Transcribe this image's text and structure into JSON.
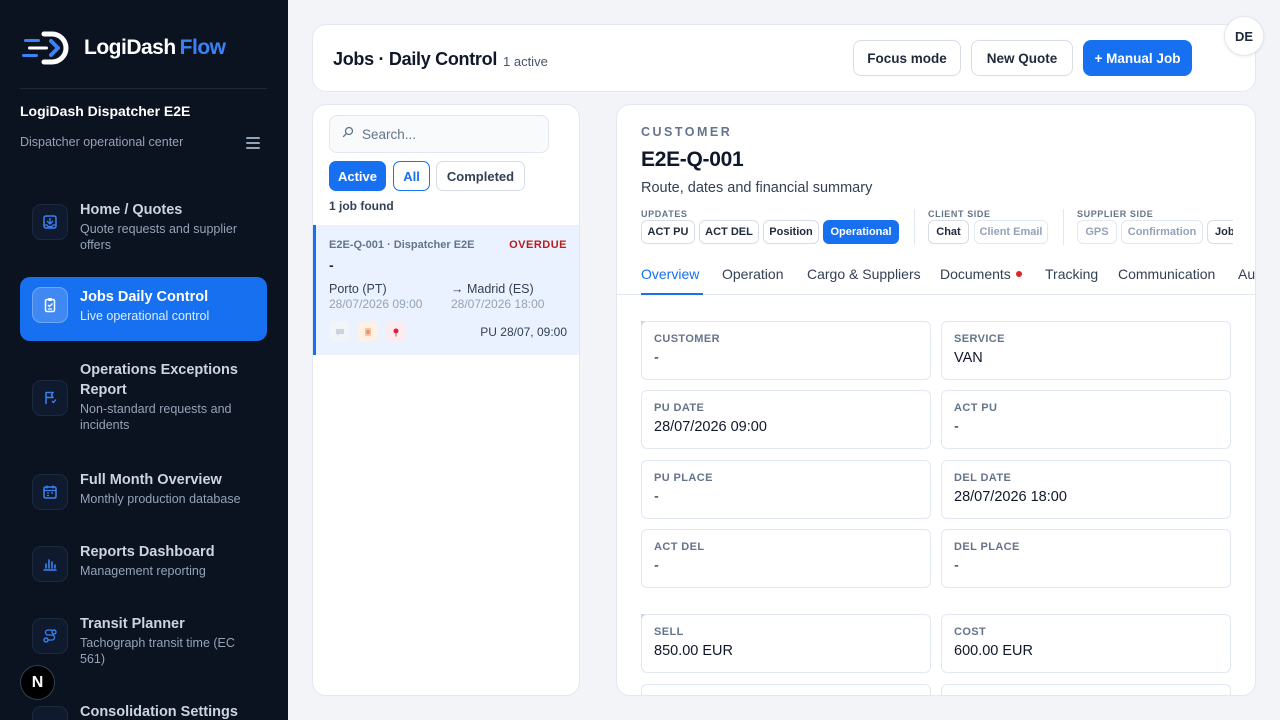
{
  "brand": {
    "name": "LogiDash",
    "accent": "Flow"
  },
  "org": {
    "name": "LogiDash Dispatcher E2E",
    "subtitle": "Dispatcher operational center"
  },
  "nav": [
    {
      "title": "Home / Quotes",
      "desc": "Quote requests and supplier offers",
      "icon": "inbox-icon"
    },
    {
      "title": "Jobs Daily Control",
      "desc": "Live operational control",
      "icon": "clipboard-icon",
      "active": true
    },
    {
      "title": "Operations Exceptions Report",
      "desc": "Non-standard requests and incidents",
      "icon": "flag-icon"
    },
    {
      "title": "Full Month Overview",
      "desc": "Monthly production database",
      "icon": "calendar-icon"
    },
    {
      "title": "Reports Dashboard",
      "desc": "Management reporting",
      "icon": "bar-chart-icon"
    },
    {
      "title": "Transit Planner",
      "desc": "Tachograph transit time (EC 561)",
      "icon": "route-icon"
    },
    {
      "title": "Consolidation Settings",
      "desc": "",
      "icon": "settings-icon"
    }
  ],
  "n_badge": "N",
  "header": {
    "title": "Jobs · Daily Control",
    "subtitle": "1 active",
    "focus_label": "Focus mode",
    "quote_label": "New Quote",
    "manual_label": "+ Manual Job",
    "avatar": "DE"
  },
  "list": {
    "search_placeholder": "Search...",
    "filters": {
      "active": "Active",
      "all": "All",
      "completed": "Completed"
    },
    "found": "1 job found",
    "job": {
      "id": "E2E-Q-001 · Dispatcher E2E",
      "status": "OVERDUE",
      "customer": "-",
      "from": "Porto (PT)",
      "from_date": "28/07/2026 09:00",
      "to": "→ Madrid (ES)",
      "to_date": "28/07/2026 18:00",
      "pu": "PU 28/07, 09:00"
    }
  },
  "detail": {
    "eyebrow": "CUSTOMER",
    "title": "E2E-Q-001",
    "subtitle": "Route, dates and financial summary",
    "groups": {
      "updates": "UPDATES",
      "client": "CLIENT SIDE",
      "supplier": "SUPPLIER SIDE"
    },
    "chips": {
      "act_pu": "ACT PU",
      "act_del": "ACT DEL",
      "position": "Position",
      "operational": "Operational",
      "chat": "Chat",
      "client_email": "Client Email",
      "gps": "GPS",
      "confirmation": "Confirmation",
      "job": "Job"
    },
    "tabs": [
      "Overview",
      "Operation",
      "Cargo & Suppliers",
      "Documents",
      "Tracking",
      "Communication",
      "Au"
    ],
    "fields": {
      "customer": {
        "label": "CUSTOMER",
        "value": "-"
      },
      "service": {
        "label": "SERVICE",
        "value": "VAN"
      },
      "pu_date": {
        "label": "PU DATE",
        "value": "28/07/2026 09:00"
      },
      "act_pu": {
        "label": "ACT PU",
        "value": "-"
      },
      "pu_place": {
        "label": "PU PLACE",
        "value": "-"
      },
      "del_date": {
        "label": "DEL DATE",
        "value": "28/07/2026 18:00"
      },
      "act_del": {
        "label": "ACT DEL",
        "value": "-"
      },
      "del_place": {
        "label": "DEL PLACE",
        "value": "-"
      },
      "sell": {
        "label": "SELL",
        "value": "850.00 EUR"
      },
      "cost": {
        "label": "COST",
        "value": "600.00 EUR"
      }
    }
  },
  "colors": {
    "primary": "#1670f0",
    "sidebar": "#0b1220",
    "overdue": "#b91c1c"
  }
}
